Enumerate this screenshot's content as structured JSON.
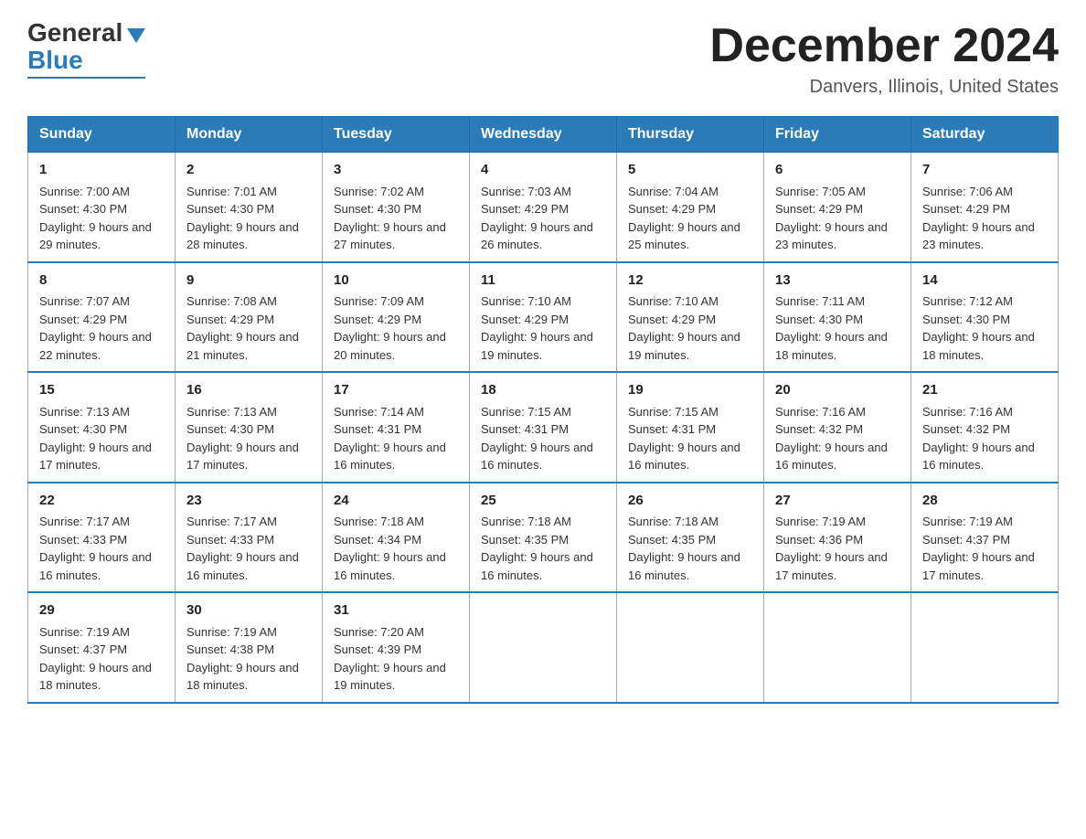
{
  "header": {
    "logo_general": "General",
    "logo_blue": "Blue",
    "month_title": "December 2024",
    "location": "Danvers, Illinois, United States"
  },
  "days_of_week": [
    "Sunday",
    "Monday",
    "Tuesday",
    "Wednesday",
    "Thursday",
    "Friday",
    "Saturday"
  ],
  "weeks": [
    [
      {
        "day": "1",
        "sunrise": "7:00 AM",
        "sunset": "4:30 PM",
        "daylight": "9 hours and 29 minutes."
      },
      {
        "day": "2",
        "sunrise": "7:01 AM",
        "sunset": "4:30 PM",
        "daylight": "9 hours and 28 minutes."
      },
      {
        "day": "3",
        "sunrise": "7:02 AM",
        "sunset": "4:30 PM",
        "daylight": "9 hours and 27 minutes."
      },
      {
        "day": "4",
        "sunrise": "7:03 AM",
        "sunset": "4:29 PM",
        "daylight": "9 hours and 26 minutes."
      },
      {
        "day": "5",
        "sunrise": "7:04 AM",
        "sunset": "4:29 PM",
        "daylight": "9 hours and 25 minutes."
      },
      {
        "day": "6",
        "sunrise": "7:05 AM",
        "sunset": "4:29 PM",
        "daylight": "9 hours and 23 minutes."
      },
      {
        "day": "7",
        "sunrise": "7:06 AM",
        "sunset": "4:29 PM",
        "daylight": "9 hours and 23 minutes."
      }
    ],
    [
      {
        "day": "8",
        "sunrise": "7:07 AM",
        "sunset": "4:29 PM",
        "daylight": "9 hours and 22 minutes."
      },
      {
        "day": "9",
        "sunrise": "7:08 AM",
        "sunset": "4:29 PM",
        "daylight": "9 hours and 21 minutes."
      },
      {
        "day": "10",
        "sunrise": "7:09 AM",
        "sunset": "4:29 PM",
        "daylight": "9 hours and 20 minutes."
      },
      {
        "day": "11",
        "sunrise": "7:10 AM",
        "sunset": "4:29 PM",
        "daylight": "9 hours and 19 minutes."
      },
      {
        "day": "12",
        "sunrise": "7:10 AM",
        "sunset": "4:29 PM",
        "daylight": "9 hours and 19 minutes."
      },
      {
        "day": "13",
        "sunrise": "7:11 AM",
        "sunset": "4:30 PM",
        "daylight": "9 hours and 18 minutes."
      },
      {
        "day": "14",
        "sunrise": "7:12 AM",
        "sunset": "4:30 PM",
        "daylight": "9 hours and 18 minutes."
      }
    ],
    [
      {
        "day": "15",
        "sunrise": "7:13 AM",
        "sunset": "4:30 PM",
        "daylight": "9 hours and 17 minutes."
      },
      {
        "day": "16",
        "sunrise": "7:13 AM",
        "sunset": "4:30 PM",
        "daylight": "9 hours and 17 minutes."
      },
      {
        "day": "17",
        "sunrise": "7:14 AM",
        "sunset": "4:31 PM",
        "daylight": "9 hours and 16 minutes."
      },
      {
        "day": "18",
        "sunrise": "7:15 AM",
        "sunset": "4:31 PM",
        "daylight": "9 hours and 16 minutes."
      },
      {
        "day": "19",
        "sunrise": "7:15 AM",
        "sunset": "4:31 PM",
        "daylight": "9 hours and 16 minutes."
      },
      {
        "day": "20",
        "sunrise": "7:16 AM",
        "sunset": "4:32 PM",
        "daylight": "9 hours and 16 minutes."
      },
      {
        "day": "21",
        "sunrise": "7:16 AM",
        "sunset": "4:32 PM",
        "daylight": "9 hours and 16 minutes."
      }
    ],
    [
      {
        "day": "22",
        "sunrise": "7:17 AM",
        "sunset": "4:33 PM",
        "daylight": "9 hours and 16 minutes."
      },
      {
        "day": "23",
        "sunrise": "7:17 AM",
        "sunset": "4:33 PM",
        "daylight": "9 hours and 16 minutes."
      },
      {
        "day": "24",
        "sunrise": "7:18 AM",
        "sunset": "4:34 PM",
        "daylight": "9 hours and 16 minutes."
      },
      {
        "day": "25",
        "sunrise": "7:18 AM",
        "sunset": "4:35 PM",
        "daylight": "9 hours and 16 minutes."
      },
      {
        "day": "26",
        "sunrise": "7:18 AM",
        "sunset": "4:35 PM",
        "daylight": "9 hours and 16 minutes."
      },
      {
        "day": "27",
        "sunrise": "7:19 AM",
        "sunset": "4:36 PM",
        "daylight": "9 hours and 17 minutes."
      },
      {
        "day": "28",
        "sunrise": "7:19 AM",
        "sunset": "4:37 PM",
        "daylight": "9 hours and 17 minutes."
      }
    ],
    [
      {
        "day": "29",
        "sunrise": "7:19 AM",
        "sunset": "4:37 PM",
        "daylight": "9 hours and 18 minutes."
      },
      {
        "day": "30",
        "sunrise": "7:19 AM",
        "sunset": "4:38 PM",
        "daylight": "9 hours and 18 minutes."
      },
      {
        "day": "31",
        "sunrise": "7:20 AM",
        "sunset": "4:39 PM",
        "daylight": "9 hours and 19 minutes."
      },
      {
        "day": "",
        "sunrise": "",
        "sunset": "",
        "daylight": ""
      },
      {
        "day": "",
        "sunrise": "",
        "sunset": "",
        "daylight": ""
      },
      {
        "day": "",
        "sunrise": "",
        "sunset": "",
        "daylight": ""
      },
      {
        "day": "",
        "sunrise": "",
        "sunset": "",
        "daylight": ""
      }
    ]
  ],
  "labels": {
    "sunrise_prefix": "Sunrise: ",
    "sunset_prefix": "Sunset: ",
    "daylight_prefix": "Daylight: "
  }
}
